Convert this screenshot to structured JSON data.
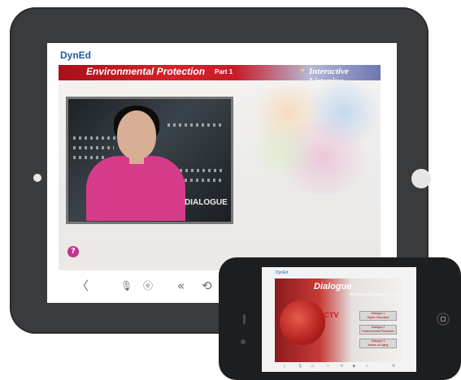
{
  "app": {
    "logo": "DynEd",
    "banner_title": "Environmental Protection",
    "banner_part": "Part 1",
    "banner_star": "✦",
    "banner_right": "Interactive Listening"
  },
  "video": {
    "caption": "DIALOGUE"
  },
  "help": {
    "label": "?"
  },
  "toolbar": {
    "back": "〈",
    "mic": "🎙",
    "ear": "ⓔ",
    "rewind": "«",
    "replay": "⟲"
  },
  "phone": {
    "logo": "DynEd",
    "title": "Dialogue",
    "subtitle": "An Advanced Listening Course",
    "brand": "CCTV",
    "options": [
      {
        "line1": "Dialogue 1",
        "line2": "Higher Education"
      },
      {
        "line1": "Dialogue 2",
        "line2": "Environmental Protection"
      },
      {
        "line1": "Dialogue 3",
        "line2": "Issues on Aging"
      }
    ],
    "toolbar": [
      "〈",
      "🎙",
      "ⓔ",
      "«",
      "⟲",
      "▶",
      "»",
      "⚙"
    ]
  },
  "colors": {
    "banner_red": "#c81c26",
    "accent_pink": "#c2338e",
    "logo_blue": "#1e5ca8"
  }
}
